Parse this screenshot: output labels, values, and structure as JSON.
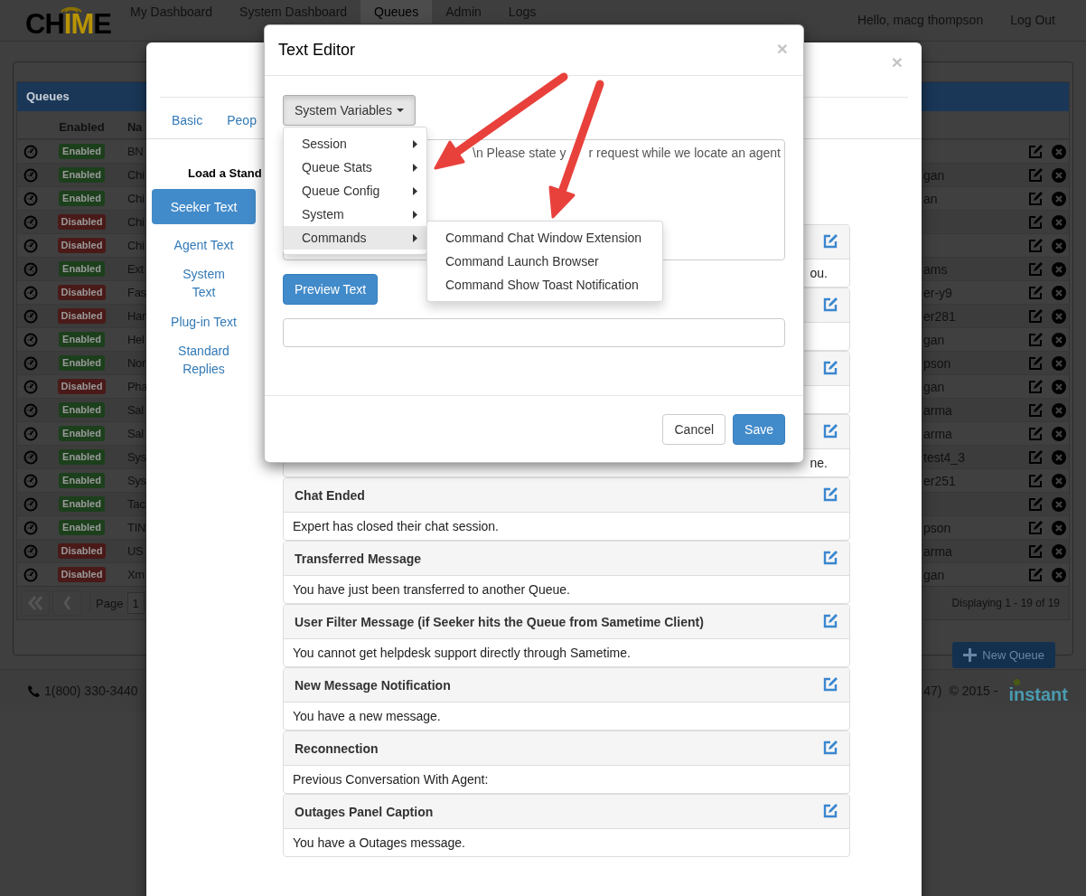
{
  "nav": {
    "logo": [
      {
        "text": "CH",
        "accent": false
      },
      {
        "text": "IM",
        "accent": true
      },
      {
        "text": "E",
        "accent": false
      }
    ],
    "items": [
      {
        "label": "My Dashboard",
        "selected": false
      },
      {
        "label": "System Dashboard",
        "selected": false
      },
      {
        "label": "Queues",
        "selected": true
      },
      {
        "label": "Admin",
        "selected": false
      },
      {
        "label": "Logs",
        "selected": false
      }
    ],
    "greeting": "Hello, macg thompson",
    "logout": "Log Out"
  },
  "queues": {
    "title": "Queues",
    "columns": [
      "Enabled",
      "Na"
    ],
    "rows": [
      {
        "status": "Enabled",
        "enabled": true,
        "name": "BN"
      },
      {
        "status": "Enabled",
        "enabled": true,
        "name": "Chi",
        "owner": "gan"
      },
      {
        "status": "Enabled",
        "enabled": true,
        "name": "Chi",
        "owner": "an"
      },
      {
        "status": "Disabled",
        "enabled": false,
        "name": "Chi"
      },
      {
        "status": "Disabled",
        "enabled": false,
        "name": "Chi"
      },
      {
        "status": "Enabled",
        "enabled": true,
        "name": "Ext",
        "owner": "ams"
      },
      {
        "status": "Disabled",
        "enabled": false,
        "name": "Fas",
        "owner": "er-y9"
      },
      {
        "status": "Disabled",
        "enabled": false,
        "name": "Har",
        "owner": "er281"
      },
      {
        "status": "Enabled",
        "enabled": true,
        "name": "Hel",
        "owner": "gan"
      },
      {
        "status": "Enabled",
        "enabled": true,
        "name": "Nor",
        "owner": "pson"
      },
      {
        "status": "Disabled",
        "enabled": false,
        "name": "Pha",
        "owner": "gan"
      },
      {
        "status": "Enabled",
        "enabled": true,
        "name": "Sal",
        "owner": "arma"
      },
      {
        "status": "Enabled",
        "enabled": true,
        "name": "Sal",
        "owner": "arma"
      },
      {
        "status": "Enabled",
        "enabled": true,
        "name": "Sys",
        "owner": "test4_3"
      },
      {
        "status": "Enabled",
        "enabled": true,
        "name": "Sys",
        "owner": "er251"
      },
      {
        "status": "Enabled",
        "enabled": true,
        "name": "Tac"
      },
      {
        "status": "Enabled",
        "enabled": true,
        "name": "TIN",
        "owner": "pson"
      },
      {
        "status": "Disabled",
        "enabled": false,
        "name": "US",
        "owner": "arma"
      },
      {
        "status": "Disabled",
        "enabled": false,
        "name": "Xm",
        "owner": "gan"
      }
    ],
    "pager": {
      "page_label": "Page",
      "page": "1",
      "summary": "Displaying 1 - 19 of 19"
    },
    "new_button": "New Queue"
  },
  "footer": {
    "phone": "1(800) 330-3440",
    "fragment": "47)",
    "copyright": "© 2015 -",
    "brand": "instant"
  },
  "settings_modal": {
    "close": "×",
    "tabs": [
      {
        "label": "Basic",
        "selected": false
      },
      {
        "label": "Peop",
        "selected": false
      }
    ],
    "heading": "Load a Stand",
    "pills": [
      {
        "label": "Seeker Text",
        "selected": true
      },
      {
        "label": "Agent Text",
        "selected": false
      },
      {
        "label": "System Text",
        "selected": false
      },
      {
        "label": "Plug-in Text",
        "selected": false
      },
      {
        "label": "Standard Replies",
        "selected": false
      }
    ],
    "panels": [
      {
        "kind": "cut",
        "body": "ou."
      },
      {
        "kind": "cut"
      },
      {
        "kind": "cut"
      },
      {
        "kind": "cut",
        "body": "ne."
      },
      {
        "kind": "full",
        "title": "Chat Ended",
        "body": "Expert has closed their chat session."
      },
      {
        "kind": "full",
        "title": "Transferred Message",
        "body": "You have just been transferred to another Queue."
      },
      {
        "kind": "full",
        "title": "User Filter Message (if Seeker hits the Queue from Sametime Client)",
        "body": "You cannot get helpdesk support directly through Sametime."
      },
      {
        "kind": "full",
        "title": "New Message Notification",
        "body": "You have a new message."
      },
      {
        "kind": "full",
        "title": "Reconnection",
        "body": "Previous Conversation With Agent:"
      },
      {
        "kind": "full",
        "title": "Outages Panel Caption",
        "body": "You have a Outages message."
      }
    ]
  },
  "text_editor": {
    "title": "Text Editor",
    "close": "×",
    "variables_button": "System Variables",
    "menu": [
      {
        "label": "Session",
        "selected": false
      },
      {
        "label": "Queue Stats",
        "selected": false
      },
      {
        "label": "Queue Config",
        "selected": false
      },
      {
        "label": "System",
        "selected": false
      },
      {
        "label": "Commands",
        "selected": true
      }
    ],
    "submenu": [
      {
        "label": "Command Chat Window Extension"
      },
      {
        "label": "Command Launch Browser"
      },
      {
        "label": "Command Show Toast Notification"
      }
    ],
    "message": [
      "\\n Please state y",
      "r request while we locate an agent"
    ],
    "preview_button": "Preview Text",
    "buttons": [
      {
        "label": "Cancel",
        "kind": "default"
      },
      {
        "label": "Save",
        "kind": "primary"
      }
    ]
  }
}
